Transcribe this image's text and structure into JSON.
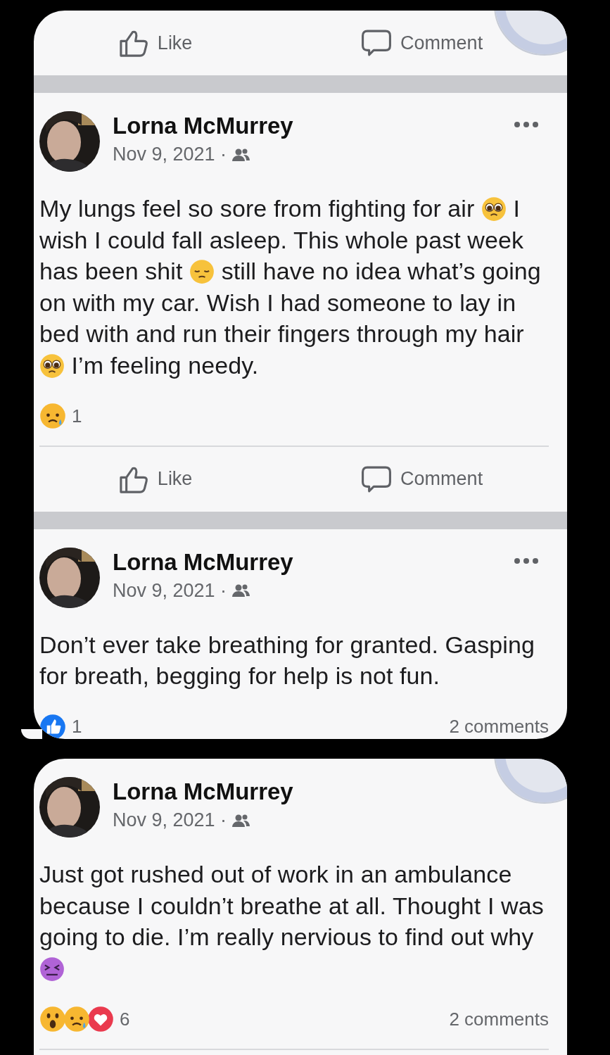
{
  "bubbles": [
    {
      "top_actions": [
        {
          "kind": "like",
          "label": "Like"
        },
        {
          "kind": "comment",
          "label": "Comment"
        }
      ],
      "tapback": true,
      "tail": true,
      "posts": [
        {
          "author": "Lorna McMurrey",
          "date": "Nov 9, 2021 ·",
          "menu": true,
          "text": [
            {
              "kind": "text",
              "text": "My lungs feel so sore from fighting for air "
            },
            {
              "kind": "pleading"
            },
            {
              "kind": "text",
              "text": " I wish I could fall asleep. This whole past week has been shit "
            },
            {
              "kind": "pensive"
            },
            {
              "kind": "text",
              "text": " still have no idea what’s going on with my car. Wish I had someone to lay in bed with and run their fingers through my hair "
            },
            {
              "kind": "pleading"
            },
            {
              "kind": "text",
              "text": " I’m feeling needy."
            }
          ],
          "reactions": [
            {
              "kind": "sad"
            }
          ],
          "reaction_count": "1",
          "actions": [
            {
              "kind": "like",
              "label": "Like"
            },
            {
              "kind": "comment",
              "label": "Comment"
            }
          ]
        },
        {
          "author": "Lorna McMurrey",
          "date": "Nov 9, 2021 ·",
          "menu": true,
          "text": [
            {
              "kind": "text",
              "text": "Don’t ever take breathing for granted. Gasping for breath, begging for help is not fun."
            }
          ],
          "reactions": [
            {
              "kind": "like"
            }
          ],
          "reaction_count": "1",
          "comments": "2 comments"
        }
      ]
    },
    {
      "tapback": true,
      "posts": [
        {
          "author": "Lorna McMurrey",
          "date": "Nov 9, 2021 ·",
          "text": [
            {
              "kind": "text",
              "text": "Just got rushed out of work in an ambulance because I couldn’t breathe at all. Thought I was going to die. I’m really nervious to find out why "
            },
            {
              "kind": "dizzy"
            }
          ],
          "reactions": [
            {
              "kind": "wow"
            },
            {
              "kind": "sad"
            },
            {
              "kind": "love"
            }
          ],
          "reaction_count": "6",
          "comments": "2 comments",
          "divider": true
        }
      ]
    }
  ]
}
